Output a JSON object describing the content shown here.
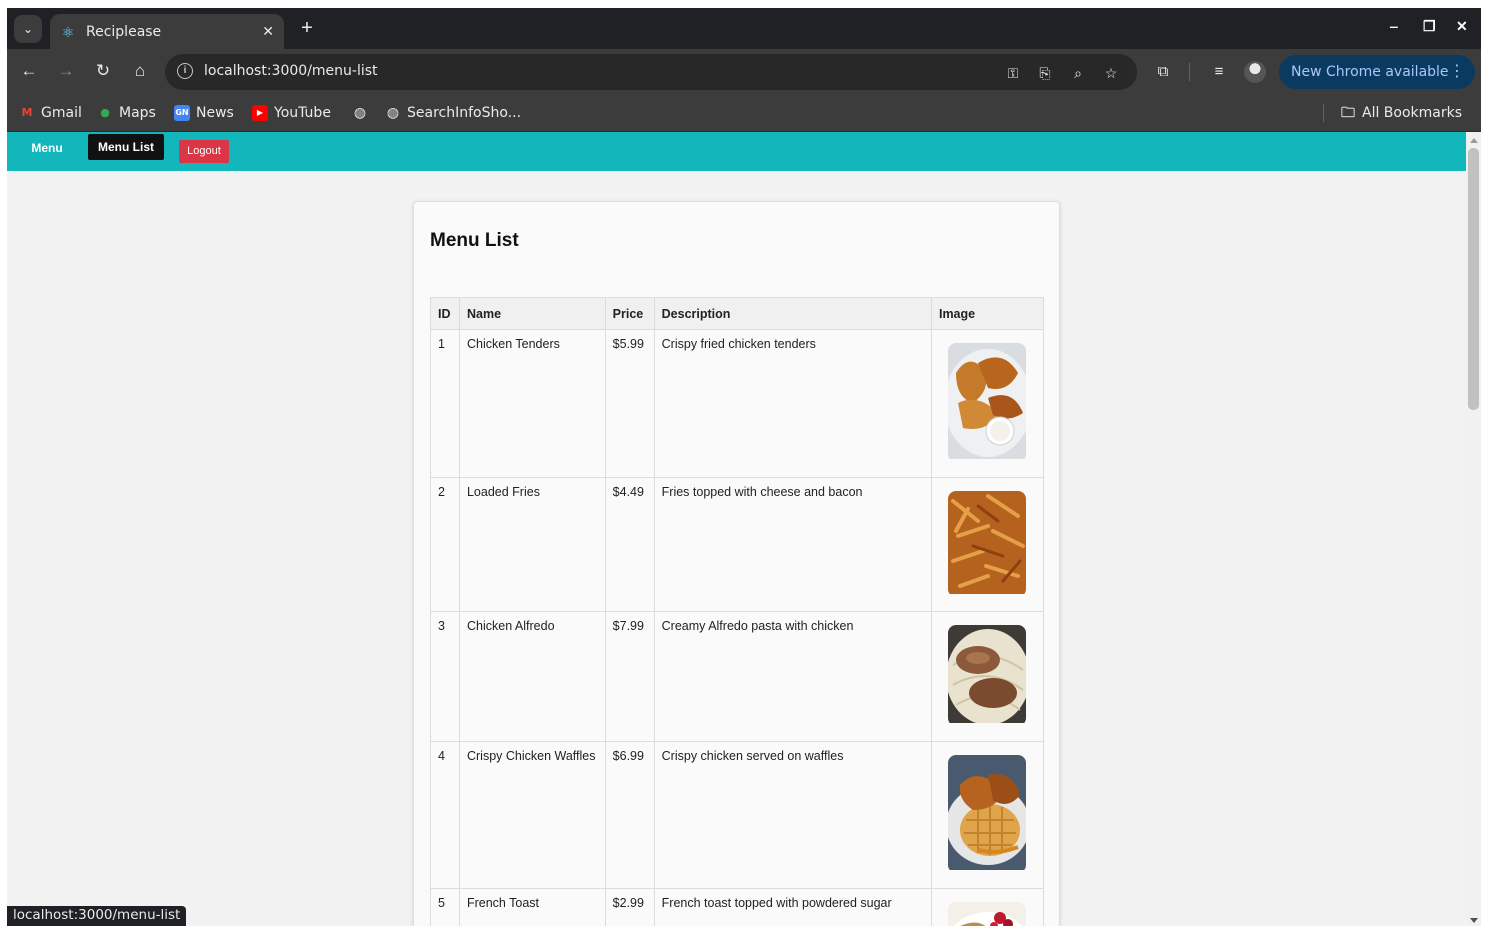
{
  "browser": {
    "tab_title": "Reciplease",
    "url": "localhost:3000/menu-list",
    "update_label": "New Chrome available",
    "bookmarks": [
      "Gmail",
      "Maps",
      "News",
      "YouTube",
      "SearchInfoSho...",
      "All Bookmarks"
    ],
    "status_url": "localhost:3000/menu-list"
  },
  "appnav": {
    "menu": "Menu",
    "menu_list": "Menu List",
    "logout": "Logout"
  },
  "page": {
    "title": "Menu List",
    "columns": [
      "ID",
      "Name",
      "Price",
      "Description",
      "Image"
    ],
    "rows": [
      {
        "id": "1",
        "name": "Chicken Tenders",
        "price": "$5.99",
        "description": "Crispy fried chicken tenders",
        "image": "chicken-tenders-photo"
      },
      {
        "id": "2",
        "name": "Loaded Fries",
        "price": "$4.49",
        "description": "Fries topped with cheese and bacon",
        "image": "loaded-fries-photo"
      },
      {
        "id": "3",
        "name": "Chicken Alfredo",
        "price": "$7.99",
        "description": "Creamy Alfredo pasta with chicken",
        "image": "chicken-alfredo-photo"
      },
      {
        "id": "4",
        "name": "Crispy Chicken Waffles",
        "price": "$6.99",
        "description": "Crispy chicken served on waffles",
        "image": "chicken-waffles-photo"
      },
      {
        "id": "5",
        "name": "French Toast",
        "price": "$2.99",
        "description": "French toast topped with powdered sugar",
        "image": "french-toast-photo"
      }
    ]
  },
  "colors": {
    "nav_teal": "#12b7bb",
    "logout_red": "#dc3545",
    "update_pill": "#0b3a61"
  }
}
